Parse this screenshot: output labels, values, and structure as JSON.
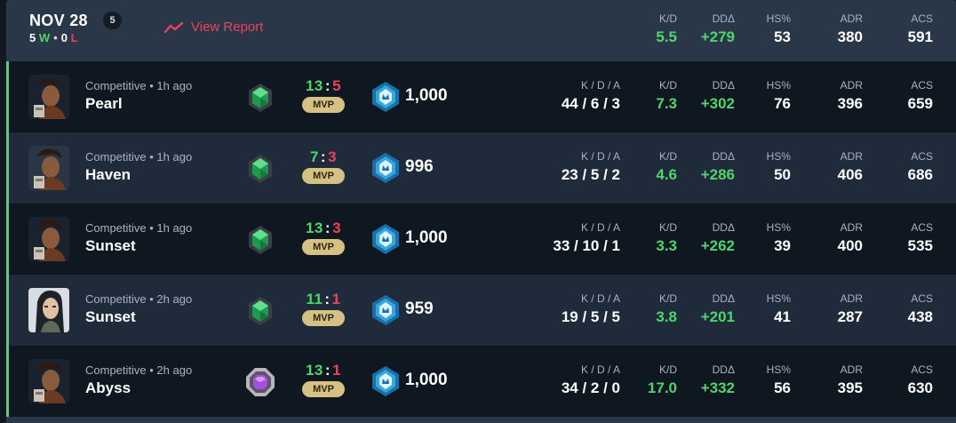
{
  "header": {
    "date": "NOV 28",
    "match_count": "5",
    "wins": "5",
    "wins_suffix": "W",
    "losses": "0",
    "losses_suffix": "L",
    "view_report": "View Report",
    "stats": {
      "kd_label": "K/D",
      "kd": "5.5",
      "dd_label": "DDΔ",
      "dd": "+279",
      "hs_label": "HS%",
      "hs": "53",
      "adr_label": "ADR",
      "adr": "380",
      "acs_label": "ACS",
      "acs": "591"
    }
  },
  "labels": {
    "kda": "K / D / A",
    "kd": "K/D",
    "dd": "DDΔ",
    "hs": "HS%",
    "adr": "ADR",
    "acs": "ACS",
    "mvp": "MVP"
  },
  "matches": [
    {
      "mode": "Competitive • 1h ago",
      "map": "Pearl",
      "agent_icon": "agent-portrait-male",
      "rank_icon": "emerald-gem-icon",
      "score_a": "13",
      "score_b": "5",
      "badge": "MVP",
      "rr_icon": "ascendant-rank-icon",
      "rr": "1,000",
      "kda": "44 / 6 / 3",
      "kd": "7.3",
      "dd": "+302",
      "hs": "76",
      "adr": "396",
      "acs": "659"
    },
    {
      "mode": "Competitive • 1h ago",
      "map": "Haven",
      "agent_icon": "agent-portrait-male",
      "rank_icon": "emerald-gem-icon",
      "score_a": "7",
      "score_b": "3",
      "badge": "MVP",
      "rr_icon": "ascendant-rank-icon",
      "rr": "996",
      "kda": "23 / 5 / 2",
      "kd": "4.6",
      "dd": "+286",
      "hs": "50",
      "adr": "406",
      "acs": "686"
    },
    {
      "mode": "Competitive • 1h ago",
      "map": "Sunset",
      "agent_icon": "agent-portrait-male",
      "rank_icon": "emerald-gem-icon",
      "score_a": "13",
      "score_b": "3",
      "badge": "MVP",
      "rr_icon": "ascendant-rank-icon",
      "rr": "1,000",
      "kda": "33 / 10 / 1",
      "kd": "3.3",
      "dd": "+262",
      "hs": "39",
      "adr": "400",
      "acs": "535"
    },
    {
      "mode": "Competitive • 2h ago",
      "map": "Sunset",
      "agent_icon": "agent-portrait-female",
      "rank_icon": "emerald-gem-icon",
      "score_a": "11",
      "score_b": "1",
      "badge": "MVP",
      "rr_icon": "ascendant-rank-icon",
      "rr": "959",
      "kda": "19 / 5 / 5",
      "kd": "3.8",
      "dd": "+201",
      "hs": "41",
      "adr": "287",
      "acs": "438"
    },
    {
      "mode": "Competitive • 2h ago",
      "map": "Abyss",
      "agent_icon": "agent-portrait-male",
      "rank_icon": "purple-octagon-icon",
      "score_a": "13",
      "score_b": "1",
      "badge": "MVP",
      "rr_icon": "ascendant-rank-icon",
      "rr": "1,000",
      "kda": "34 / 2 / 0",
      "kd": "17.0",
      "dd": "+332",
      "hs": "56",
      "adr": "395",
      "acs": "630"
    }
  ],
  "colors": {
    "win": "#4fd56b",
    "loss": "#e8455a",
    "mvp_badge": "#d6c184",
    "header_bg": "#2a3748",
    "row_dark": "#0f1821",
    "row_light": "#1f2b3a"
  }
}
